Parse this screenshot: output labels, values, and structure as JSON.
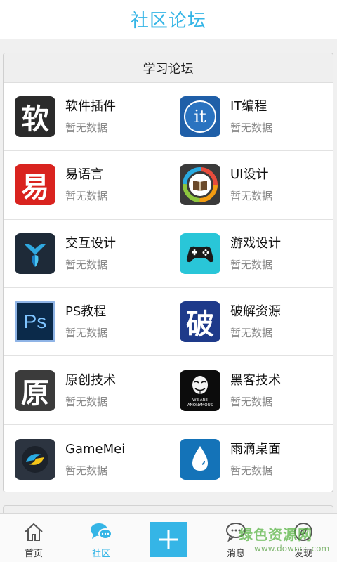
{
  "header": {
    "title": "社区论坛"
  },
  "section": {
    "title": "学习论坛",
    "items": [
      {
        "name": "软件插件",
        "sub": "暂无数据",
        "icon": "ruan-character-icon",
        "glyph": "软"
      },
      {
        "name": "IT编程",
        "sub": "暂无数据",
        "icon": "it-logo-icon",
        "glyph": "it"
      },
      {
        "name": "易语言",
        "sub": "暂无数据",
        "icon": "yi-character-icon",
        "glyph": "易"
      },
      {
        "name": "UI设计",
        "sub": "暂无数据",
        "icon": "book-ring-icon"
      },
      {
        "name": "交互设计",
        "sub": "暂无数据",
        "icon": "tri-petal-icon"
      },
      {
        "name": "游戏设计",
        "sub": "暂无数据",
        "icon": "gamepad-icon"
      },
      {
        "name": "PS教程",
        "sub": "暂无数据",
        "icon": "photoshop-icon",
        "glyph": "Ps"
      },
      {
        "name": "破解资源",
        "sub": "暂无数据",
        "icon": "po-character-icon",
        "glyph": "破"
      },
      {
        "name": "原创技术",
        "sub": "暂无数据",
        "icon": "yuan-character-icon",
        "glyph": "原"
      },
      {
        "name": "黑客技术",
        "sub": "暂无数据",
        "icon": "anonymous-mask-icon",
        "glyph": "WE ARE ANONYMOUS"
      },
      {
        "name": "GameMei",
        "sub": "暂无数据",
        "icon": "gamemei-logo-icon"
      },
      {
        "name": "雨滴桌面",
        "sub": "暂无数据",
        "icon": "raindrop-icon"
      }
    ]
  },
  "tabbar": {
    "tabs": [
      {
        "label": "首页",
        "icon": "home-icon"
      },
      {
        "label": "社区",
        "icon": "chat-bubbles-icon",
        "active": true
      },
      {
        "label": "",
        "icon": "plus-icon"
      },
      {
        "label": "消息",
        "icon": "message-icon"
      },
      {
        "label": "发现",
        "icon": "compass-icon"
      }
    ]
  },
  "watermark": {
    "line1": "绿色资源网",
    "line2": "www.downcc.com"
  },
  "colors": {
    "accent": "#35b5e6"
  }
}
